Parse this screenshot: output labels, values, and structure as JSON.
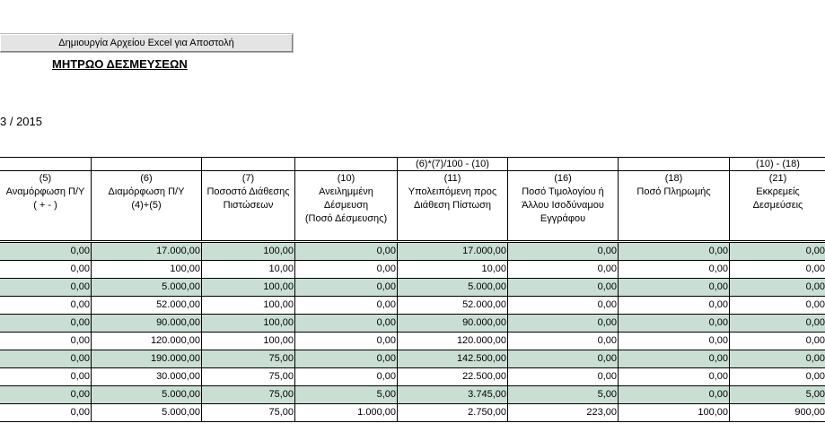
{
  "toolbar": {
    "excel_button_label": "Δημιουργία Αρχείου Excel για Αποστολή"
  },
  "report": {
    "title": "ΜΗΤΡΩΟ ΔΕΣΜΕΥΣΕΩΝ",
    "period": "3 / 2015"
  },
  "table": {
    "formulas": [
      "",
      "",
      "",
      "",
      "(6)*(7)/100 - (10)",
      "",
      "",
      "(10) - (18)"
    ],
    "headers": [
      [
        "(5)",
        "Αναμόρφωση Π/Υ",
        "( + - )"
      ],
      [
        "(6)",
        "Διαμόρφωση Π/Υ",
        "(4)+(5)"
      ],
      [
        "(7)",
        "Ποσοστό Διάθεσης",
        "Πιστώσεων"
      ],
      [
        "(10)",
        "Ανειλημμένη",
        "Δέσμευση",
        "(Ποσό Δέσμευσης)"
      ],
      [
        "(11)",
        "Υπολειπόμενη προς",
        "Διάθεση Πίστωση"
      ],
      [
        "(16)",
        "Ποσό Τιμολογίου ή",
        "Άλλου Ισοδύναμου",
        "Εγγράφου"
      ],
      [
        "(18)",
        "Ποσό Πληρωμής"
      ],
      [
        "(21)",
        "Εκκρεμείς",
        "Δεσμεύσεις"
      ]
    ],
    "rows": [
      [
        "0,00",
        "17.000,00",
        "100,00",
        "0,00",
        "17.000,00",
        "0,00",
        "0,00",
        "0,00"
      ],
      [
        "0,00",
        "100,00",
        "10,00",
        "0,00",
        "10,00",
        "0,00",
        "0,00",
        "0,00"
      ],
      [
        "0,00",
        "5.000,00",
        "100,00",
        "0,00",
        "5.000,00",
        "0,00",
        "0,00",
        "0,00"
      ],
      [
        "0,00",
        "52.000,00",
        "100,00",
        "0,00",
        "52.000,00",
        "0,00",
        "0,00",
        "0,00"
      ],
      [
        "0,00",
        "90.000,00",
        "100,00",
        "0,00",
        "90.000,00",
        "0,00",
        "0,00",
        "0,00"
      ],
      [
        "0,00",
        "120.000,00",
        "100,00",
        "0,00",
        "120.000,00",
        "0,00",
        "0,00",
        "0,00"
      ],
      [
        "0,00",
        "190.000,00",
        "75,00",
        "0,00",
        "142.500,00",
        "0,00",
        "0,00",
        "0,00"
      ],
      [
        "0,00",
        "30.000,00",
        "75,00",
        "0,00",
        "22.500,00",
        "0,00",
        "0,00",
        "0,00"
      ],
      [
        "0,00",
        "5.000,00",
        "75,00",
        "5,00",
        "3.745,00",
        "5,00",
        "0,00",
        "5,00"
      ],
      [
        "0,00",
        "5.000,00",
        "75,00",
        "1.000,00",
        "2.750,00",
        "223,00",
        "100,00",
        "900,00"
      ]
    ]
  },
  "colors": {
    "row_shade": "#c9dfd3",
    "button_face": "#e4e4e4"
  }
}
